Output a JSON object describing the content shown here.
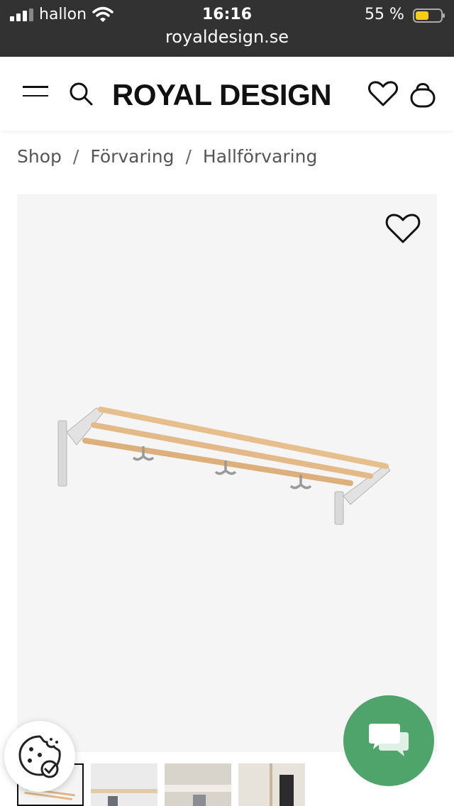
{
  "status_bar": {
    "carrier": "hallon",
    "time": "16:16",
    "battery_percent": "55 %",
    "url": "royaldesign.se"
  },
  "header": {
    "logo": "ROYAL DESIGN"
  },
  "breadcrumb": {
    "items": [
      "Shop",
      "Förvaring",
      "Hallförvaring"
    ],
    "separator": "/"
  },
  "icons": {
    "menu": "hamburger-icon",
    "search": "search-icon",
    "wishlist": "heart-icon",
    "cart": "shopping-bag-icon",
    "cookie": "cookie-icon",
    "chat": "chat-icon"
  },
  "colors": {
    "status_bar_bg": "#323232",
    "chat_button": "#4ea46a",
    "image_bg": "#f5f5f5"
  },
  "product": {
    "thumbnails_count": 4,
    "active_thumbnail": 1
  }
}
